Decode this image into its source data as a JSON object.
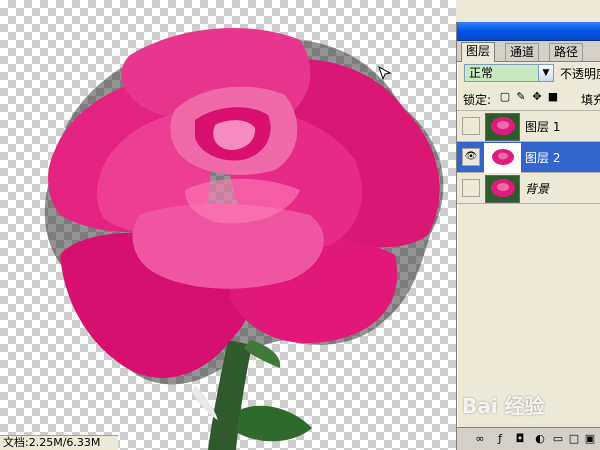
{
  "status_bar": {
    "text": "文档:2.25M/6.33M"
  },
  "layers_panel": {
    "tabs": [
      {
        "label": "图层",
        "active": true
      },
      {
        "label": "通道",
        "active": false
      },
      {
        "label": "路径",
        "active": false
      }
    ],
    "blend_mode": "正常",
    "opacity_label": "不透明度",
    "lock_label": "锁定:",
    "fill_label": "填充",
    "layers": [
      {
        "name": "图层 1",
        "visible": false,
        "selected": false,
        "italic": false,
        "thumb": "rose"
      },
      {
        "name": "图层 2",
        "visible": true,
        "selected": true,
        "italic": false,
        "thumb": "rose-cutout"
      },
      {
        "name": "背景",
        "visible": false,
        "selected": false,
        "italic": true,
        "thumb": "rose"
      }
    ],
    "bottom_icons": [
      "link-icon",
      "layer-style-icon",
      "mask-icon",
      "adjustment-icon",
      "folder-icon",
      "new-layer-icon",
      "trash-icon"
    ]
  },
  "watermark": {
    "text": "Bai 经验"
  },
  "colors": {
    "selection": "#3366cc",
    "panel_bg": "#ece9d8",
    "rose": "#e01b7e",
    "blend_field": "#c8e8c0"
  }
}
